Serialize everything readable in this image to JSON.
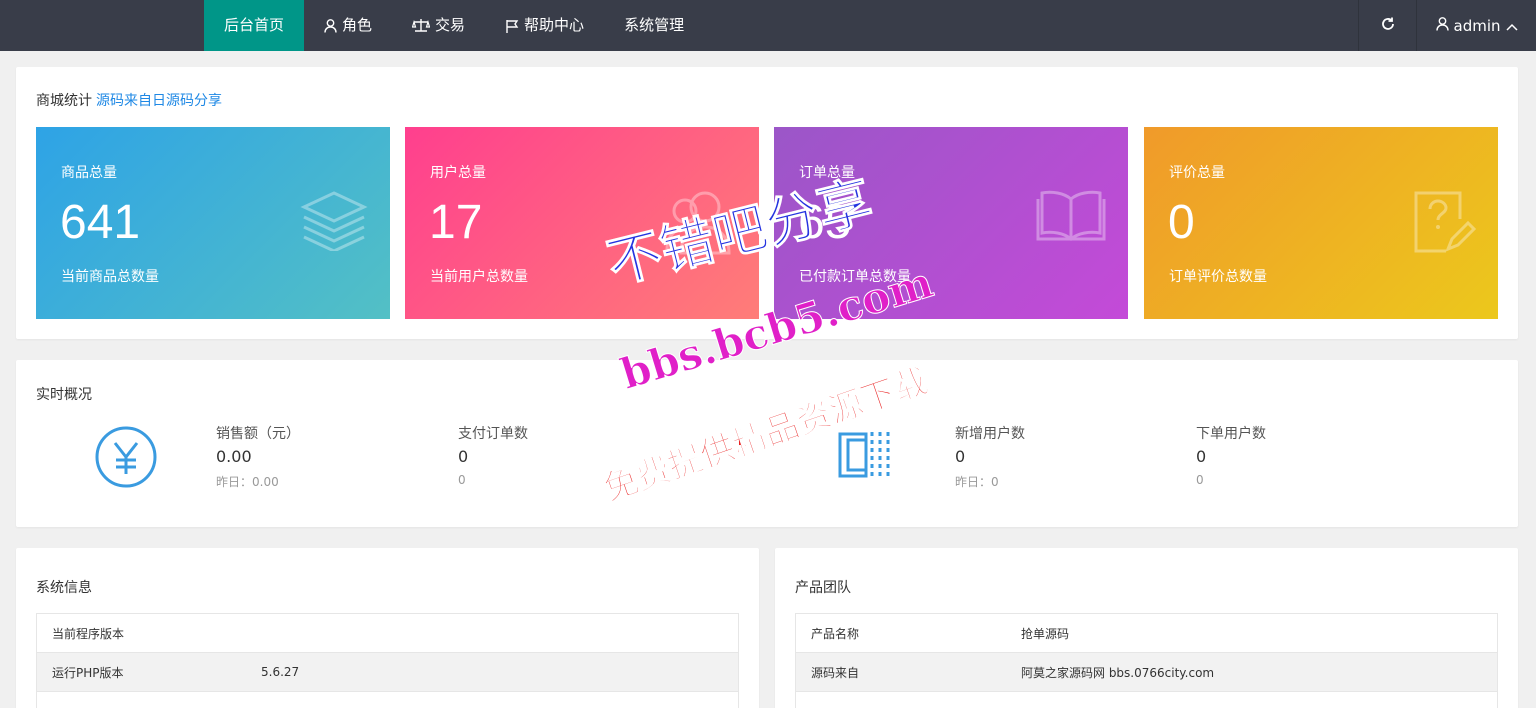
{
  "nav": {
    "items": [
      {
        "label": "后台首页",
        "icon": ""
      },
      {
        "label": "角色",
        "icon": "user-icon"
      },
      {
        "label": "交易",
        "icon": "scale-icon"
      },
      {
        "label": "帮助中心",
        "icon": "flag-icon"
      },
      {
        "label": "系统管理",
        "icon": ""
      }
    ],
    "username": "admin"
  },
  "stats_card": {
    "title": "商城统计",
    "title_link": "源码来自日源码分享",
    "tiles": [
      {
        "label": "商品总量",
        "value": "641",
        "desc": "当前商品总数量",
        "icon": "layers-icon"
      },
      {
        "label": "用户总量",
        "value": "17",
        "desc": "当前用户总数量",
        "icon": "users-icon"
      },
      {
        "label": "订单总量",
        "value": "65",
        "desc": "已付款订单总数量",
        "icon": "book-icon"
      },
      {
        "label": "评价总量",
        "value": "0",
        "desc": "订单评价总数量",
        "icon": "question-edit-icon"
      }
    ]
  },
  "realtime": {
    "title": "实时概况",
    "sales_label": "销售额（元）",
    "sales_value": "0.00",
    "sales_yesterday": "昨日：0.00",
    "paid_orders_label": "支付订单数",
    "paid_orders_value": "0",
    "paid_orders_yesterday": "0",
    "new_users_label": "新增用户数",
    "new_users_value": "0",
    "new_users_yesterday": "昨日：0",
    "order_users_label": "下单用户数",
    "order_users_value": "0",
    "order_users_yesterday": "0"
  },
  "system_info": {
    "title": "系统信息",
    "rows": [
      {
        "key": "当前程序版本",
        "value": ""
      },
      {
        "key": "运行PHP版本",
        "value": "5.6.27"
      }
    ]
  },
  "team": {
    "title": "产品团队",
    "rows": [
      {
        "key": "产品名称",
        "value": "抢单源码"
      },
      {
        "key": "源码来自",
        "value": "阿莫之家源码网 bbs.0766city.com"
      }
    ]
  },
  "watermark": {
    "line1": "不错吧分享",
    "line2": "bbs.bcb5.com",
    "line3": "免费提供精品资源下载"
  },
  "colors": {
    "topbar": "#393d49",
    "active_nav": "#009688",
    "link": "#1e88e5",
    "icon_blue": "#3a9be0"
  }
}
